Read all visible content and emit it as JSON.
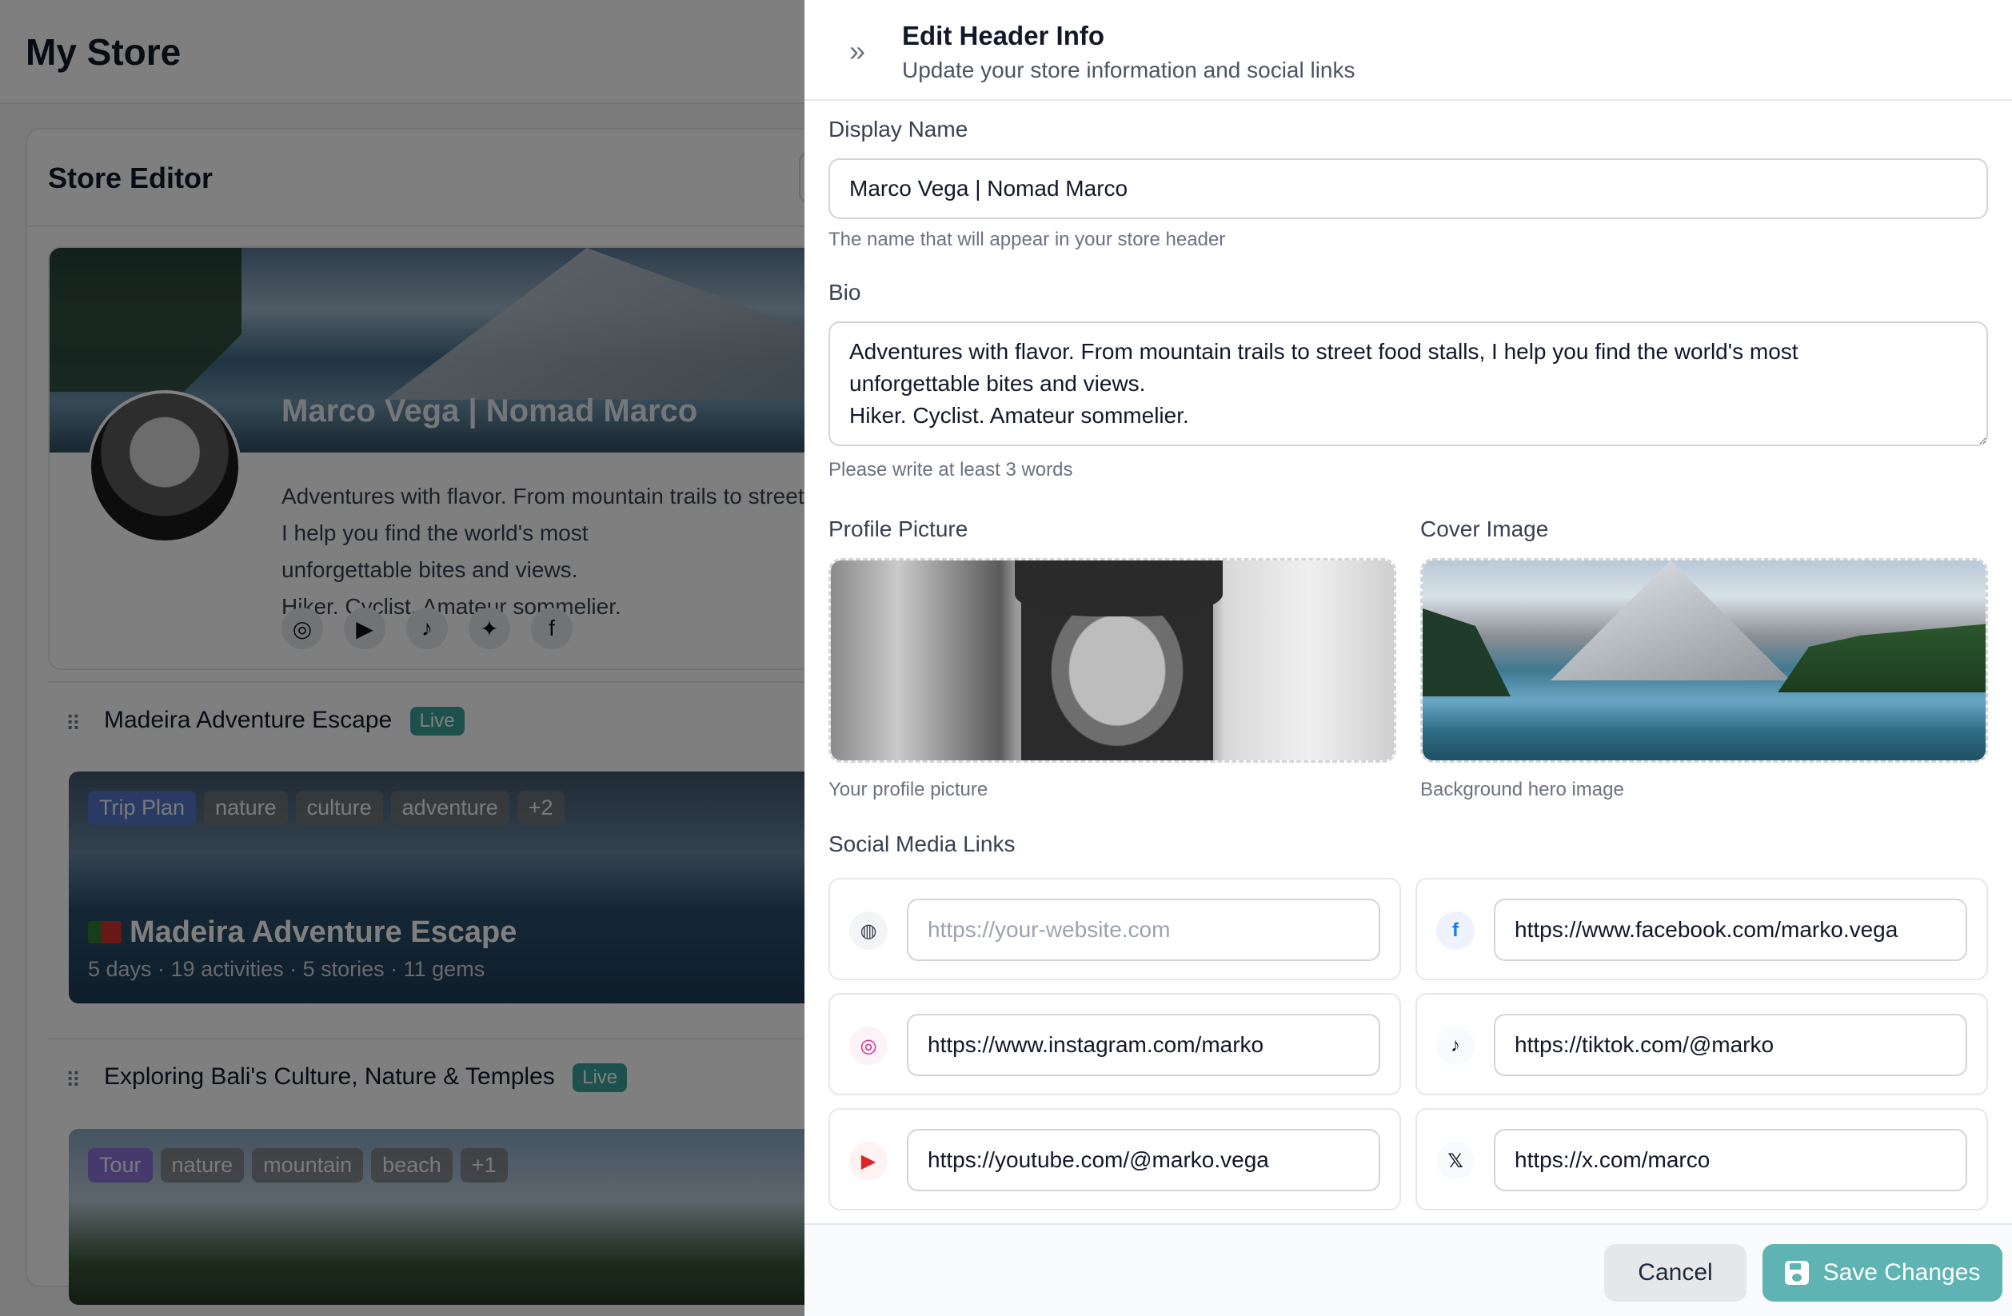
{
  "background": {
    "page_title": "My Store",
    "editor_title": "Store Editor",
    "profile": {
      "name": "Marco Vega | Nomad Marco",
      "bio": "Adventures with flavor. From mountain trails to street food stalls, I help you find the world's most\nunforgettable bites and views.\nHiker. Cyclist. Amateur sommelier.",
      "socials": [
        "instagram-icon",
        "youtube-icon",
        "tiktok-icon",
        "twitter-icon",
        "facebook-icon"
      ]
    },
    "trips": [
      {
        "title": "Madeira Adventure Escape",
        "status": "Live",
        "type_tag": "Trip Plan",
        "tags": [
          "nature",
          "culture",
          "adventure",
          "+2"
        ],
        "card_title": "Madeira Adventure Escape",
        "meta": "5 days · 19 activities · 5 stories · 11 gems"
      },
      {
        "title": "Exploring Bali's Culture, Nature & Temples",
        "status": "Live",
        "type_tag": "Tour",
        "tags": [
          "nature",
          "mountain",
          "beach",
          "+1"
        ]
      }
    ]
  },
  "panel": {
    "title": "Edit Header Info",
    "subtitle": "Update your store information and social links",
    "display_name": {
      "label": "Display Name",
      "value": "Marco Vega | Nomad Marco",
      "help": "The name that will appear in your store header"
    },
    "bio": {
      "label": "Bio",
      "value": "Adventures with flavor. From mountain trails to street food stalls, I help you find the world's most\nunforgettable bites and views.\nHiker. Cyclist. Amateur sommelier.",
      "help": "Please write at least 3 words"
    },
    "profile_picture": {
      "label": "Profile Picture",
      "help": "Your profile picture"
    },
    "cover_image": {
      "label": "Cover Image",
      "help": "Background hero image"
    },
    "social": {
      "label": "Social Media Links",
      "website": {
        "icon": "globe-icon",
        "value": "",
        "placeholder": "https://your-website.com"
      },
      "facebook": {
        "icon": "facebook-icon",
        "value": "https://www.facebook.com/marko.vega"
      },
      "instagram": {
        "icon": "instagram-icon",
        "value": "https://www.instagram.com/marko"
      },
      "tiktok": {
        "icon": "tiktok-icon",
        "value": "https://tiktok.com/@marko"
      },
      "youtube": {
        "icon": "youtube-icon",
        "value": "https://youtube.com/@marko.vega"
      },
      "x": {
        "icon": "x-icon",
        "value": "https://x.com/marco"
      }
    },
    "footer": {
      "cancel_label": "Cancel",
      "save_label": "Save Changes"
    }
  },
  "colors": {
    "accent": "#5fb3b3",
    "live_badge": "#3aa39a",
    "overlay": "rgba(0,0,0,0.5)"
  }
}
